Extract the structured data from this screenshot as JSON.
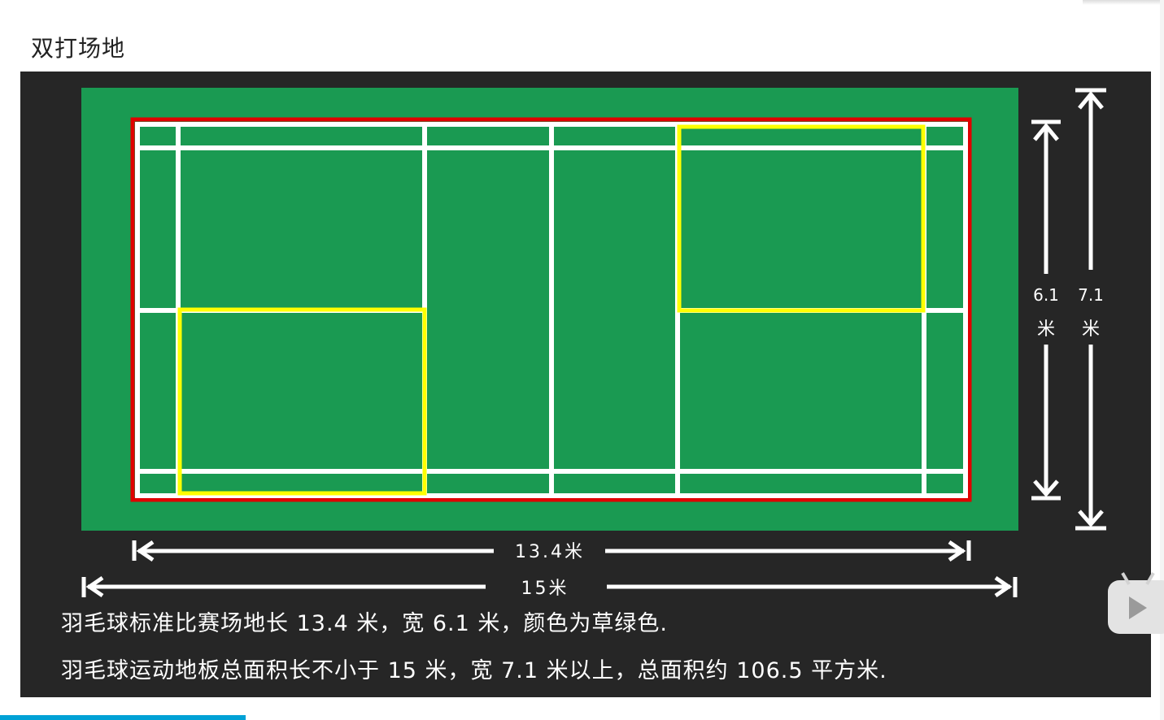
{
  "page": {
    "title": "双打场地"
  },
  "diagram": {
    "dimensions": {
      "inner_length": "13.4米",
      "outer_length": "15米",
      "inner_width_value": "6.1",
      "inner_width_unit": "米",
      "outer_width_value": "7.1",
      "outer_width_unit": "米"
    },
    "captions": [
      "羽毛球标准比赛场地长 13.4 米，宽 6.1 米，颜色为草绿色.",
      "羽毛球运动地板总面积长不小于 15 米，宽 7.1 米以上，总面积约 106.5 平方米."
    ]
  },
  "colors": {
    "panel": "#262626",
    "court_green": "#1a9a52",
    "boundary_red": "#e00000",
    "service_yellow": "#ffff00",
    "line_white": "#ffffff"
  },
  "overlay": {
    "play_icon": "play-icon"
  }
}
